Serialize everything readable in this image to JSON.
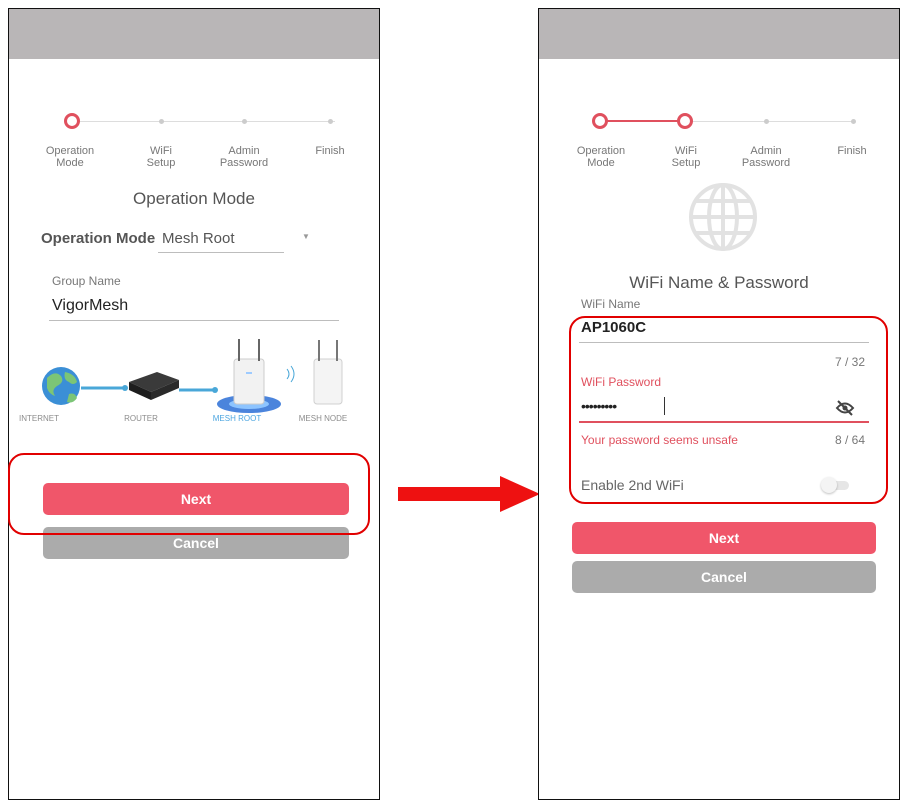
{
  "left_screen": {
    "steps": [
      "Operation\nMode",
      "WiFi\nSetup",
      "Admin\nPassword",
      "Finish"
    ],
    "heading": "Operation Mode",
    "operation_mode": {
      "label": "Operation Mode",
      "value": "Mesh Root"
    },
    "group_name": {
      "label": "Group Name",
      "value": "VigorMesh"
    },
    "diagram_labels": [
      "INTERNET",
      "ROUTER",
      "MESH ROOT",
      "MESH NODE"
    ],
    "next_label": "Next",
    "cancel_label": "Cancel"
  },
  "right_screen": {
    "steps": [
      "Operation\nMode",
      "WiFi\nSetup",
      "Admin\nPassword",
      "Finish"
    ],
    "heading": "WiFi Name & Password",
    "wifi_name": {
      "label": "WiFi Name",
      "value": "AP1060C",
      "counter": "7 / 32"
    },
    "wifi_password": {
      "label": "WiFi Password",
      "value": "•••••••••",
      "warning": "Your password seems unsafe",
      "counter": "8 / 64"
    },
    "enable_2nd_wifi": {
      "label": "Enable 2nd WiFi",
      "enabled": false
    },
    "next_label": "Next",
    "cancel_label": "Cancel"
  },
  "colors": {
    "accent": "#f0566a",
    "stepper_active": "#e0505e",
    "callout": "#e10000",
    "cancel": "#ababab",
    "statusbar": "#b9b6b7"
  }
}
